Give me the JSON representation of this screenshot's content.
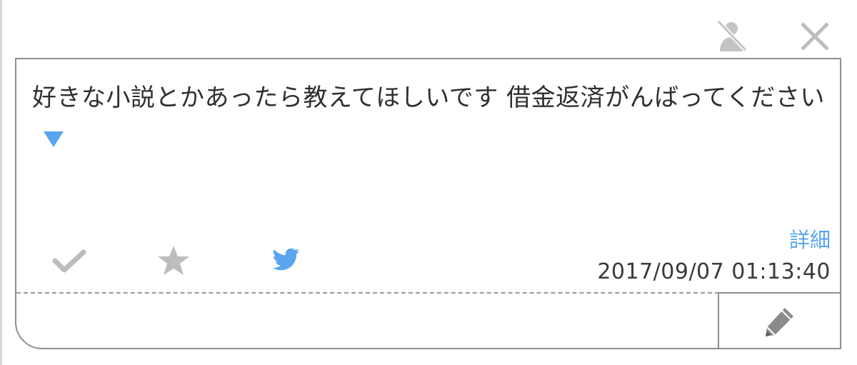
{
  "message": {
    "text": "好きな小説とかあったら教えてほしいです 借金返済がんばってください"
  },
  "details_link": "詳細",
  "timestamp": "2017/09/07 01:13:40",
  "icons": {
    "block": "block-user-icon",
    "close": "close-icon",
    "check": "check-icon",
    "star": "star-icon",
    "twitter": "twitter-bird-icon",
    "edit": "pencil-icon",
    "expand": "triangle-down-icon"
  },
  "colors": {
    "accent": "#5aa5ee",
    "icon_gray": "#bdbdbd",
    "border": "#8f8f8f",
    "text": "#2f2f2f"
  }
}
